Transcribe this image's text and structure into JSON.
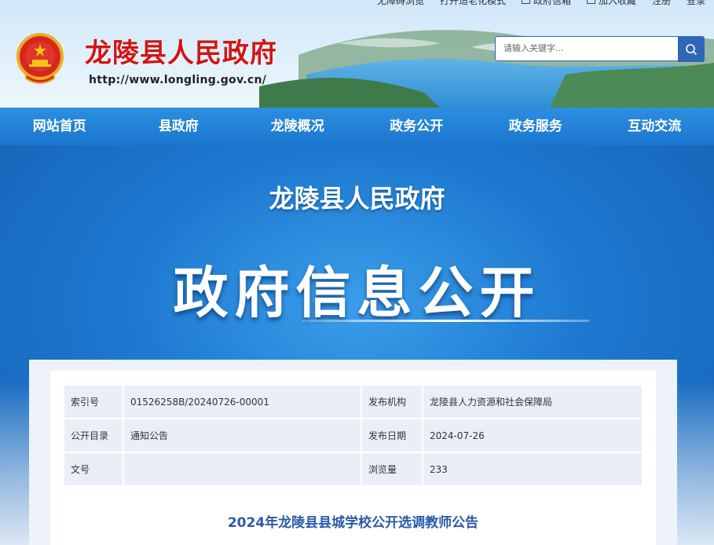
{
  "toplinks": [
    {
      "label": "无障碍浏览",
      "icon": ""
    },
    {
      "label": "打开适老化模式",
      "icon": ""
    },
    {
      "label": "政府信箱",
      "icon": "mail-icon"
    },
    {
      "label": "加入收藏",
      "icon": "star-icon"
    },
    {
      "label": "注册",
      "icon": ""
    },
    {
      "label": "登录",
      "icon": ""
    }
  ],
  "header": {
    "title": "龙陵县人民政府",
    "url": "http://www.longling.gov.cn/",
    "search_placeholder": "请输入关键字..."
  },
  "nav": [
    "网站首页",
    "县政府",
    "龙陵概况",
    "政务公开",
    "政务服务",
    "互动交流"
  ],
  "banner": {
    "subtitle": "龙陵县人民政府",
    "title": "政府信息公开"
  },
  "meta": {
    "index_label": "索引号",
    "index_value": "01526258B/20240726-00001",
    "publisher_label": "发布机构",
    "publisher_value": "龙陵县人力资源和社会保障局",
    "catalog_label": "公开目录",
    "catalog_value": "通知公告",
    "date_label": "发布日期",
    "date_value": "2024-07-26",
    "docno_label": "文号",
    "docno_value": "",
    "views_label": "浏览量",
    "views_value": "233"
  },
  "document": {
    "title": "2024年龙陵县县城学校公开选调教师公告"
  },
  "colors": {
    "brand_red": "#d01515",
    "nav_blue": "#1b76cf",
    "title_blue": "#2a5aa8"
  }
}
